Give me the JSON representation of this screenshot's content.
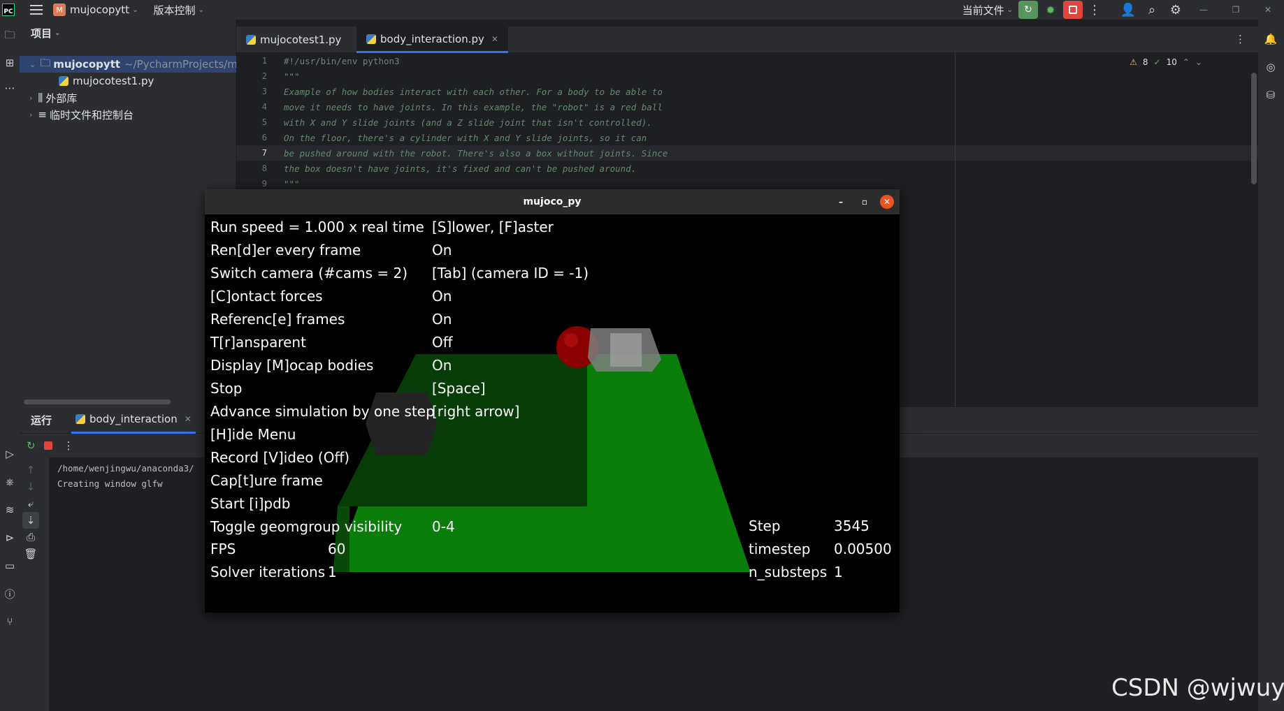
{
  "titlebar": {
    "project_name": "mujocopytt",
    "project_initial": "M",
    "vcs_menu": "版本控制",
    "run_config": "当前文件"
  },
  "project_panel": {
    "title": "项目",
    "root_name": "mujocopytt",
    "root_path": "~/PycharmProjects/mu",
    "file1": "mujocotest1.py",
    "external_libs": "外部库",
    "scratches": "临时文件和控制台"
  },
  "editor": {
    "tabs": [
      "mujocotest1.py",
      "body_interaction.py"
    ],
    "line_numbers": [
      "1",
      "2",
      "3",
      "4",
      "5",
      "6",
      "7",
      "8",
      "9"
    ],
    "lines": [
      "#!/usr/bin/env python3",
      "\"\"\"",
      "Example of how bodies interact with each other. For a body to be able to",
      "move it needs to have joints. In this example, the \"robot\" is a red ball",
      "with X and Y slide joints (and a Z slide joint that isn't controlled).",
      "On the floor, there's a cylinder with X and Y slide joints, so it can",
      "be pushed around with the robot. There's also a box without joints. Since",
      "the box doesn't have joints, it's fixed and can't be pushed around.",
      "\"\"\""
    ],
    "warnings": "8",
    "weak_warnings": "10"
  },
  "run_panel": {
    "title": "运行",
    "tab": "body_interaction",
    "console": [
      "/home/wenjingwu/anaconda3/",
      "Creating window glfw"
    ]
  },
  "mujoco": {
    "window_title": "mujoco_py",
    "menu_left": [
      "Run speed = 1.000 x real time",
      "Ren[d]er every frame",
      "Switch camera (#cams = 2)",
      "[C]ontact forces",
      "Referenc[e] frames",
      "T[r]ansparent",
      "Display [M]ocap bodies",
      "Stop",
      "Advance simulation by one step",
      "[H]ide Menu",
      "Record [V]ideo (Off)",
      "Cap[t]ure frame",
      "Start [i]pdb",
      "Toggle geomgroup visibility"
    ],
    "menu_right": [
      "[S]lower, [F]aster",
      "On",
      "[Tab] (camera ID = -1)",
      "On",
      "On",
      "Off",
      "On",
      "[Space]",
      "[right arrow]",
      "",
      "",
      "",
      "",
      "0-4"
    ],
    "fps_label": "FPS",
    "fps_value": "60",
    "solver_label": "Solver iterations",
    "solver_value": "1",
    "step_label": "Step",
    "step_value": "3545",
    "timestep_label": "timestep",
    "timestep_value": "0.00500",
    "substeps_label": "n_substeps",
    "substeps_value": "1"
  },
  "watermark": "CSDN @wjwuyh",
  "colors": {
    "accent": "#3574f0",
    "run_green": "#57965c",
    "stop_red": "#e0463e",
    "floor_green": "#0a7a0a",
    "ball_red": "#8b0000"
  }
}
